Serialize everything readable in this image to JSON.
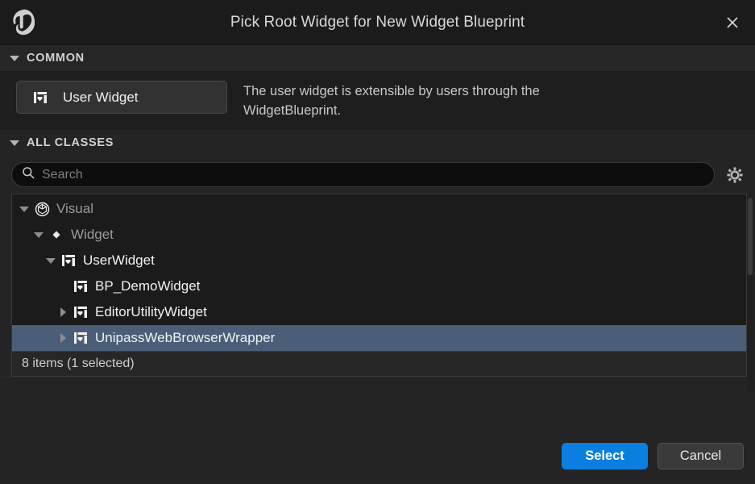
{
  "window": {
    "title": "Pick Root Widget for New Widget Blueprint",
    "logo_icon": "unreal-engine-logo",
    "close_icon": "close-icon"
  },
  "common_section": {
    "header": "COMMON",
    "collapse_icon": "chevron-down-icon",
    "button": {
      "label": "User Widget",
      "icon": "user-widget-icon"
    },
    "description": "The user widget is extensible by users through the WidgetBlueprint."
  },
  "all_classes_section": {
    "header": "ALL CLASSES",
    "collapse_icon": "chevron-down-icon",
    "search": {
      "placeholder": "Search",
      "value": "",
      "icon": "search-icon"
    },
    "settings_icon": "gear-icon",
    "tree": [
      {
        "label": "Visual",
        "icon": "class-sphere-icon",
        "indent": 0,
        "twisty": "down",
        "dim": true,
        "selected": false
      },
      {
        "label": "Widget",
        "icon": "diamond-icon",
        "indent": 1,
        "twisty": "down",
        "dim": true,
        "selected": false
      },
      {
        "label": "UserWidget",
        "icon": "user-widget-icon",
        "indent": 2,
        "twisty": "down",
        "dim": false,
        "selected": false
      },
      {
        "label": "BP_DemoWidget",
        "icon": "user-widget-icon",
        "indent": 3,
        "twisty": "none",
        "dim": false,
        "selected": false
      },
      {
        "label": "EditorUtilityWidget",
        "icon": "user-widget-icon",
        "indent": 3,
        "twisty": "right",
        "dim": false,
        "selected": false
      },
      {
        "label": "UnipassWebBrowserWrapper",
        "icon": "user-widget-icon",
        "indent": 3,
        "twisty": "right",
        "dim": false,
        "selected": true
      }
    ],
    "status": "8 items (1 selected)"
  },
  "footer": {
    "select_label": "Select",
    "cancel_label": "Cancel"
  },
  "colors": {
    "accent_blue": "#0b7fe0",
    "selection_blue": "#4a5e78",
    "window_bg": "#242424",
    "panel_bg": "#1b1b1b",
    "titlebar_bg": "#1b1b1b"
  }
}
